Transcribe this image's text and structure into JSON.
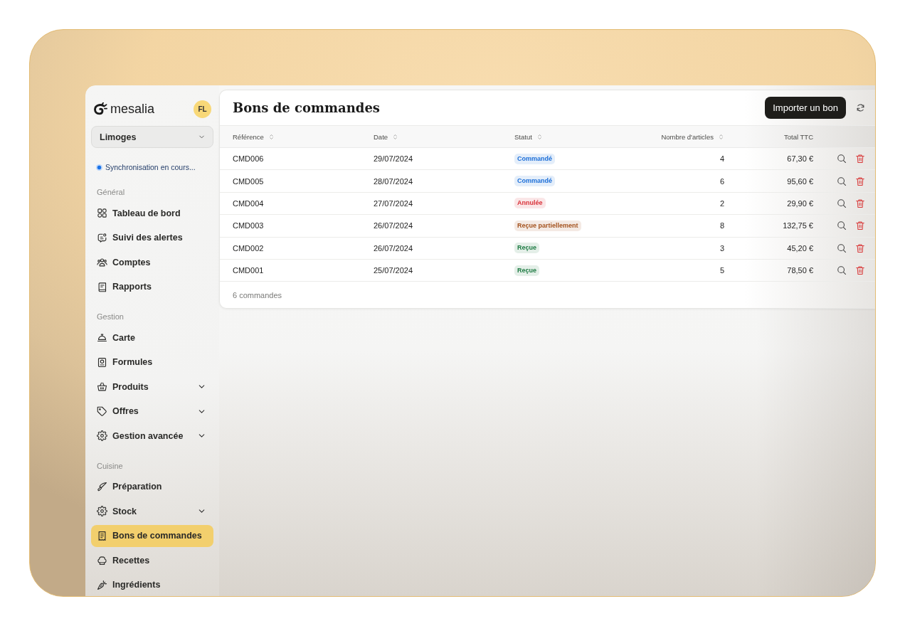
{
  "brand": {
    "name": "mesalia",
    "avatar_initials": "FL"
  },
  "location_select": {
    "value": "Limoges"
  },
  "sync_status": {
    "label": "Synchronisation en cours..."
  },
  "sidebar": {
    "sections": [
      {
        "title": "Général",
        "items": [
          {
            "label": "Tableau de bord",
            "kind": "link",
            "selected": false
          },
          {
            "label": "Suivi des alertes",
            "kind": "link",
            "selected": false
          },
          {
            "label": "Comptes",
            "kind": "link",
            "selected": false
          },
          {
            "label": "Rapports",
            "kind": "link",
            "selected": false
          }
        ]
      },
      {
        "title": "Gestion",
        "items": [
          {
            "label": "Carte",
            "kind": "link",
            "selected": false
          },
          {
            "label": "Formules",
            "kind": "link",
            "selected": false
          },
          {
            "label": "Produits",
            "kind": "group",
            "expanded": false,
            "selected": false
          },
          {
            "label": "Offres",
            "kind": "group",
            "expanded": false,
            "selected": false
          },
          {
            "label": "Gestion avancée",
            "kind": "group",
            "expanded": false,
            "selected": false
          }
        ]
      },
      {
        "title": "Cuisine",
        "items": [
          {
            "label": "Préparation",
            "kind": "link",
            "selected": false
          },
          {
            "label": "Stock",
            "kind": "group",
            "expanded": false,
            "selected": false
          },
          {
            "label": "Bons de commandes",
            "kind": "link",
            "selected": true
          },
          {
            "label": "Recettes",
            "kind": "link",
            "selected": false
          },
          {
            "label": "Ingrédients",
            "kind": "link",
            "selected": false
          }
        ]
      }
    ]
  },
  "page": {
    "title": "Bons de commandes",
    "import_button": "Importer un bon"
  },
  "table": {
    "columns": [
      {
        "label": "Référence",
        "sortable": true
      },
      {
        "label": "Date",
        "sortable": true
      },
      {
        "label": "Statut",
        "sortable": true
      },
      {
        "label": "Nombre d'articles",
        "sortable": true
      },
      {
        "label": "Total TTC",
        "sortable": false
      }
    ],
    "rows": [
      {
        "reference": "CMD006",
        "date": "29/07/2024",
        "status": {
          "label": "Commandé",
          "color": "#1d6fd8"
        },
        "items": "4",
        "total": "67,30 €"
      },
      {
        "reference": "CMD005",
        "date": "28/07/2024",
        "status": {
          "label": "Commandé",
          "color": "#1d6fd8"
        },
        "items": "6",
        "total": "95,60 €"
      },
      {
        "reference": "CMD004",
        "date": "27/07/2024",
        "status": {
          "label": "Annulée",
          "color": "#d9323a"
        },
        "items": "2",
        "total": "29,90 €"
      },
      {
        "reference": "CMD003",
        "date": "26/07/2024",
        "status": {
          "label": "Reçue partiellement",
          "color": "#a4531f"
        },
        "items": "8",
        "total": "132,75 €"
      },
      {
        "reference": "CMD002",
        "date": "26/07/2024",
        "status": {
          "label": "Reçue",
          "color": "#1e7b43"
        },
        "items": "3",
        "total": "45,20 €"
      },
      {
        "reference": "CMD001",
        "date": "25/07/2024",
        "status": {
          "label": "Reçue",
          "color": "#1e7b43"
        },
        "items": "5",
        "total": "78,50 €"
      }
    ],
    "footer": "6 commandes"
  }
}
